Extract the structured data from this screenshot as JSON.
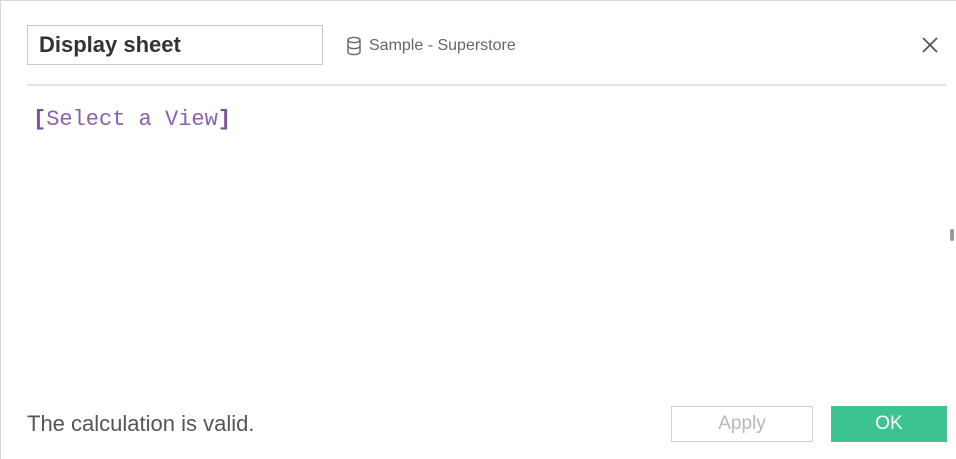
{
  "dialog": {
    "title_value": "Display sheet",
    "datasource": {
      "icon": "database-icon",
      "label": "Sample - Superstore"
    },
    "close_icon": "close-icon"
  },
  "editor": {
    "formula_open_bracket": "[",
    "formula_field": "Select a View",
    "formula_close_bracket": "]"
  },
  "footer": {
    "status_text": "The calculation is valid.",
    "apply_label": "Apply",
    "ok_label": "OK"
  },
  "colors": {
    "ok_accent": "#3cc391",
    "field_text": "#8c5fb2"
  }
}
